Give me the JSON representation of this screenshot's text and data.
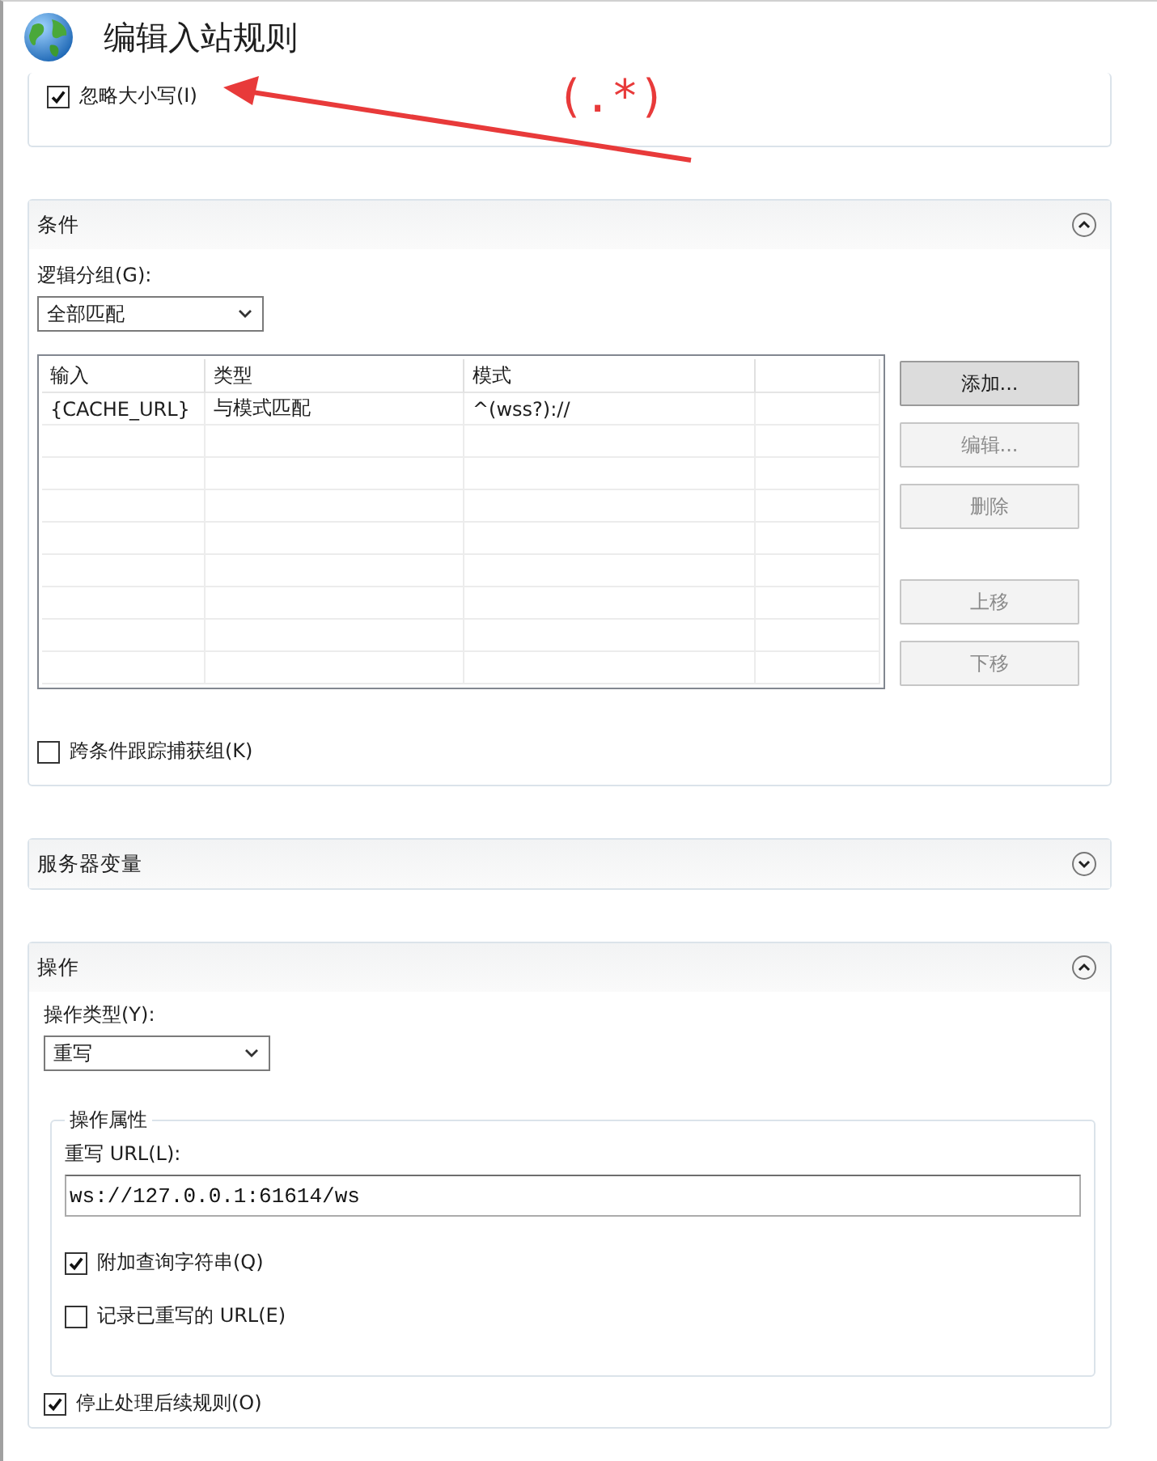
{
  "title": "编辑入站规则",
  "top_section": {
    "ignore_case": {
      "label": "忽略大小写(I)",
      "checked": true
    }
  },
  "annotation": {
    "text": "(.*)"
  },
  "conditions": {
    "title": "条件",
    "expanded": true,
    "logical_grouping": {
      "label": "逻辑分组(G):",
      "value": "全部匹配"
    },
    "table": {
      "columns": [
        "输入",
        "类型",
        "模式"
      ],
      "rows": [
        [
          "{CACHE_URL}",
          "与模式匹配",
          "^(wss?)://"
        ]
      ]
    },
    "button_groups": [
      [
        {
          "label": "添加...",
          "disabled": false
        },
        {
          "label": "编辑...",
          "disabled": true
        },
        {
          "label": "删除",
          "disabled": true
        }
      ],
      [
        {
          "label": "上移",
          "disabled": true
        },
        {
          "label": "下移",
          "disabled": true
        }
      ]
    ],
    "track_capture": {
      "label": "跨条件跟踪捕获组(K)",
      "checked": false
    }
  },
  "server_variables": {
    "title": "服务器变量",
    "expanded": false
  },
  "action": {
    "title": "操作",
    "expanded": true,
    "action_type": {
      "label": "操作类型(Y):",
      "value": "重写"
    },
    "properties": {
      "title": "操作属性",
      "rewrite_url": {
        "label": "重写 URL(L):",
        "value": "ws://127.0.0.1:61614/ws"
      },
      "options": [
        {
          "label": "附加查询字符串(Q)",
          "checked": true
        },
        {
          "label": "记录已重写的 URL(E)",
          "checked": false
        }
      ]
    },
    "stop_processing": {
      "label": "停止处理后续规则(O)",
      "checked": true
    }
  }
}
